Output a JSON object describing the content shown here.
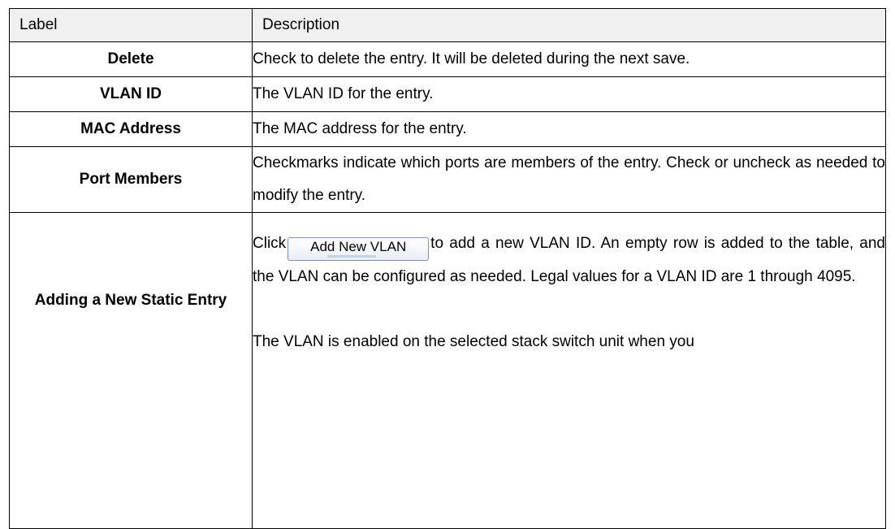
{
  "table": {
    "header": {
      "label": "Label",
      "description": "Description"
    },
    "rows": [
      {
        "label": "Delete",
        "description": "Check to delete the entry. It will be deleted during the next save."
      },
      {
        "label": "VLAN ID",
        "description": "The VLAN ID for the entry."
      },
      {
        "label": "MAC Address",
        "description": "The MAC address for the entry."
      },
      {
        "label": "Port Members",
        "description": "Checkmarks indicate which ports are members of the entry. Check or uncheck as needed to modify the entry."
      },
      {
        "label": "Adding a New Static Entry",
        "desc_before_button": "Click",
        "button_label": "Add New VLAN",
        "desc_after_button": "to add a new VLAN ID. An empty row is added to the table, and the VLAN can be configured as needed. Legal values for a VLAN ID are 1 through 4095.",
        "desc_second_paragraph": "The VLAN is enabled on the selected stack switch unit when you"
      }
    ]
  }
}
